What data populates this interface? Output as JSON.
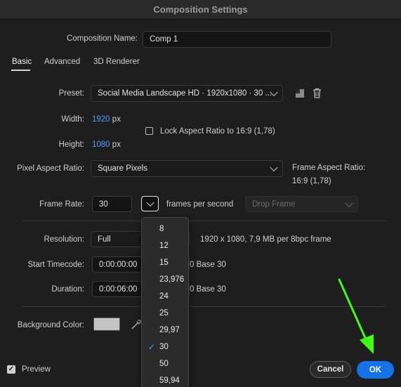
{
  "window": {
    "title": "Composition Settings"
  },
  "comp_name": {
    "label": "Composition Name:",
    "value": "Comp 1"
  },
  "tabs": [
    {
      "label": "Basic"
    },
    {
      "label": "Advanced"
    },
    {
      "label": "3D Renderer"
    }
  ],
  "preset": {
    "label": "Preset:",
    "value": "Social Media Landscape HD  ·  1920x1080 · 30 ..."
  },
  "width": {
    "label": "Width:",
    "value": "1920",
    "unit": "px"
  },
  "height": {
    "label": "Height:",
    "value": "1080",
    "unit": "px"
  },
  "lock_aspect": {
    "label": "Lock Aspect Ratio to 16:9 (1,78)",
    "checked": false
  },
  "pixel_aspect": {
    "label": "Pixel Aspect Ratio:",
    "value": "Square Pixels"
  },
  "frame_aspect": {
    "label": "Frame Aspect Ratio:",
    "value": "16:9 (1,78)"
  },
  "frame_rate": {
    "label": "Frame Rate:",
    "value": "30",
    "unit": "frames per second",
    "drop_frame": "Drop Frame"
  },
  "resolution": {
    "label": "Resolution:",
    "value": "Full",
    "info": "1920 x 1080, 7,9 MB per 8bpc frame"
  },
  "start_timecode": {
    "label": "Start Timecode:",
    "value": "0:00:00:00",
    "suffix": "0  Base 30"
  },
  "duration": {
    "label": "Duration:",
    "value": "0:00:06:00",
    "suffix": "0  Base 30"
  },
  "background": {
    "label": "Background Color:",
    "color": "#c4c4c4"
  },
  "fps_menu": {
    "options": [
      "8",
      "12",
      "15",
      "23,976",
      "24",
      "25",
      "29,97",
      "30",
      "50",
      "59,94"
    ],
    "selected": "30",
    "check_mark": "✓"
  },
  "preview": {
    "label": "Preview",
    "checked": true,
    "check_mark": "✓"
  },
  "buttons": {
    "cancel": "Cancel",
    "ok": "OK"
  },
  "colors": {
    "accent": "#1473e6",
    "link_blue": "#4f9bff",
    "annotation_arrow": "#3dff14"
  }
}
